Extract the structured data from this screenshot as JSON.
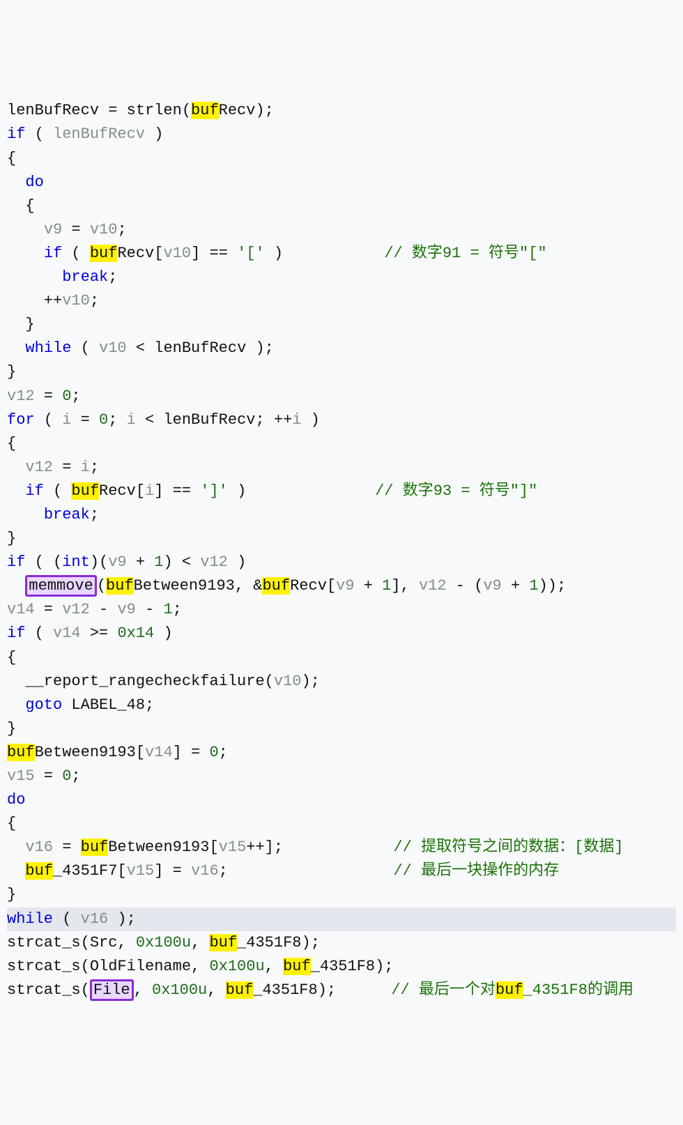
{
  "tokens": [
    {
      "t": "lenBufRecv = strlen(",
      "c": "sym"
    },
    {
      "t": "buf",
      "c": "hl-y"
    },
    {
      "t": "Recv);",
      "c": "sym"
    },
    "\n",
    {
      "t": "if",
      "c": "kw"
    },
    {
      "t": " ( ",
      "c": "sym"
    },
    {
      "t": "lenBufRecv",
      "c": "var"
    },
    {
      "t": " )",
      "c": "sym"
    },
    "\n",
    {
      "t": "{",
      "c": "sym"
    },
    "\n",
    {
      "t": "  ",
      "c": "sym"
    },
    {
      "t": "do",
      "c": "kw"
    },
    "\n",
    {
      "t": "  {",
      "c": "sym"
    },
    "\n",
    {
      "t": "    ",
      "c": "sym"
    },
    {
      "t": "v9",
      "c": "var"
    },
    {
      "t": " = ",
      "c": "sym"
    },
    {
      "t": "v10",
      "c": "var"
    },
    {
      "t": ";",
      "c": "sym"
    },
    "\n",
    {
      "t": "    ",
      "c": "sym"
    },
    {
      "t": "if",
      "c": "kw"
    },
    {
      "t": " ( ",
      "c": "sym"
    },
    {
      "t": "buf",
      "c": "hl-y"
    },
    {
      "t": "Recv[",
      "c": "sym"
    },
    {
      "t": "v10",
      "c": "var"
    },
    {
      "t": "] == ",
      "c": "sym"
    },
    {
      "t": "'['",
      "c": "char"
    },
    {
      "t": " )           ",
      "c": "sym"
    },
    {
      "t": "// 数字91 = 符号\"[\"",
      "c": "cmt"
    },
    "\n",
    {
      "t": "      ",
      "c": "sym"
    },
    {
      "t": "break",
      "c": "kw"
    },
    {
      "t": ";",
      "c": "sym"
    },
    "\n",
    {
      "t": "    ++",
      "c": "sym"
    },
    {
      "t": "v10",
      "c": "var"
    },
    {
      "t": ";",
      "c": "sym"
    },
    "\n",
    {
      "t": "  }",
      "c": "sym"
    },
    "\n",
    {
      "t": "  ",
      "c": "sym"
    },
    {
      "t": "while",
      "c": "kw"
    },
    {
      "t": " ( ",
      "c": "sym"
    },
    {
      "t": "v10",
      "c": "var"
    },
    {
      "t": " < lenBufRecv );",
      "c": "sym"
    },
    "\n",
    {
      "t": "}",
      "c": "sym"
    },
    "\n",
    {
      "t": "v12",
      "c": "var"
    },
    {
      "t": " = ",
      "c": "sym"
    },
    {
      "t": "0",
      "c": "num"
    },
    {
      "t": ";",
      "c": "sym"
    },
    "\n",
    {
      "t": "for",
      "c": "kw"
    },
    {
      "t": " ( ",
      "c": "sym"
    },
    {
      "t": "i",
      "c": "var"
    },
    {
      "t": " = ",
      "c": "sym"
    },
    {
      "t": "0",
      "c": "num"
    },
    {
      "t": "; ",
      "c": "sym"
    },
    {
      "t": "i",
      "c": "var"
    },
    {
      "t": " < lenBufRecv; ++",
      "c": "sym"
    },
    {
      "t": "i",
      "c": "var"
    },
    {
      "t": " )",
      "c": "sym"
    },
    "\n",
    {
      "t": "{",
      "c": "sym"
    },
    "\n",
    {
      "t": "  ",
      "c": "sym"
    },
    {
      "t": "v12",
      "c": "var"
    },
    {
      "t": " = ",
      "c": "sym"
    },
    {
      "t": "i",
      "c": "var"
    },
    {
      "t": ";",
      "c": "sym"
    },
    "\n",
    {
      "t": "  ",
      "c": "sym"
    },
    {
      "t": "if",
      "c": "kw"
    },
    {
      "t": " ( ",
      "c": "sym"
    },
    {
      "t": "buf",
      "c": "hl-y"
    },
    {
      "t": "Recv[",
      "c": "sym"
    },
    {
      "t": "i",
      "c": "var"
    },
    {
      "t": "] == ",
      "c": "sym"
    },
    {
      "t": "']'",
      "c": "char"
    },
    {
      "t": " )              ",
      "c": "sym"
    },
    {
      "t": "// 数字93 = 符号\"]\"",
      "c": "cmt"
    },
    "\n",
    {
      "t": "    ",
      "c": "sym"
    },
    {
      "t": "break",
      "c": "kw"
    },
    {
      "t": ";",
      "c": "sym"
    },
    "\n",
    {
      "t": "}",
      "c": "sym"
    },
    "\n",
    {
      "t": "if",
      "c": "kw"
    },
    {
      "t": " ( (",
      "c": "sym"
    },
    {
      "t": "int",
      "c": "kw"
    },
    {
      "t": ")(",
      "c": "sym"
    },
    {
      "t": "v9",
      "c": "var"
    },
    {
      "t": " + ",
      "c": "sym"
    },
    {
      "t": "1",
      "c": "num"
    },
    {
      "t": ") < ",
      "c": "sym"
    },
    {
      "t": "v12",
      "c": "var"
    },
    {
      "t": " )",
      "c": "sym"
    },
    "\n",
    {
      "t": "  ",
      "c": "sym"
    },
    {
      "t": "memmove",
      "c": "hl-box"
    },
    {
      "t": "(",
      "c": "sym"
    },
    {
      "t": "buf",
      "c": "hl-y"
    },
    {
      "t": "Between9193, &",
      "c": "sym"
    },
    {
      "t": "buf",
      "c": "hl-y"
    },
    {
      "t": "Recv[",
      "c": "sym"
    },
    {
      "t": "v9",
      "c": "var"
    },
    {
      "t": " + ",
      "c": "sym"
    },
    {
      "t": "1",
      "c": "num"
    },
    {
      "t": "], ",
      "c": "sym"
    },
    {
      "t": "v12",
      "c": "var"
    },
    {
      "t": " - (",
      "c": "sym"
    },
    {
      "t": "v9",
      "c": "var"
    },
    {
      "t": " + ",
      "c": "sym"
    },
    {
      "t": "1",
      "c": "num"
    },
    {
      "t": "));",
      "c": "sym"
    },
    "\n",
    {
      "t": "v14",
      "c": "var"
    },
    {
      "t": " = ",
      "c": "sym"
    },
    {
      "t": "v12",
      "c": "var"
    },
    {
      "t": " - ",
      "c": "sym"
    },
    {
      "t": "v9",
      "c": "var"
    },
    {
      "t": " - ",
      "c": "sym"
    },
    {
      "t": "1",
      "c": "num"
    },
    {
      "t": ";",
      "c": "sym"
    },
    "\n",
    {
      "t": "if",
      "c": "kw"
    },
    {
      "t": " ( ",
      "c": "sym"
    },
    {
      "t": "v14",
      "c": "var"
    },
    {
      "t": " >= ",
      "c": "sym"
    },
    {
      "t": "0x14",
      "c": "num"
    },
    {
      "t": " )",
      "c": "sym"
    },
    "\n",
    {
      "t": "{",
      "c": "sym"
    },
    "\n",
    {
      "t": "  __report_rangecheckfailure(",
      "c": "sym"
    },
    {
      "t": "v10",
      "c": "var"
    },
    {
      "t": ");",
      "c": "sym"
    },
    "\n",
    {
      "t": "  ",
      "c": "sym"
    },
    {
      "t": "goto",
      "c": "kw"
    },
    {
      "t": " LABEL_48;",
      "c": "sym"
    },
    "\n",
    {
      "t": "}",
      "c": "sym"
    },
    "\n",
    {
      "t": "buf",
      "c": "hl-y"
    },
    {
      "t": "Between9193[",
      "c": "sym"
    },
    {
      "t": "v14",
      "c": "var"
    },
    {
      "t": "] = ",
      "c": "sym"
    },
    {
      "t": "0",
      "c": "num"
    },
    {
      "t": ";",
      "c": "sym"
    },
    "\n",
    {
      "t": "v15",
      "c": "var"
    },
    {
      "t": " = ",
      "c": "sym"
    },
    {
      "t": "0",
      "c": "num"
    },
    {
      "t": ";",
      "c": "sym"
    },
    "\n",
    {
      "t": "do",
      "c": "kw"
    },
    "\n",
    {
      "t": "{",
      "c": "sym"
    },
    "\n",
    {
      "t": "  ",
      "c": "sym"
    },
    {
      "t": "v16",
      "c": "var"
    },
    {
      "t": " = ",
      "c": "sym"
    },
    {
      "t": "buf",
      "c": "hl-y"
    },
    {
      "t": "Between9193[",
      "c": "sym"
    },
    {
      "t": "v15",
      "c": "var"
    },
    {
      "t": "++];            ",
      "c": "sym"
    },
    {
      "t": "// 提取符号之间的数据：[数据]",
      "c": "cmt"
    },
    "\n",
    {
      "t": "  ",
      "c": "sym"
    },
    {
      "t": "buf",
      "c": "hl-y"
    },
    {
      "t": "_4351F7[",
      "c": "sym"
    },
    {
      "t": "v15",
      "c": "var"
    },
    {
      "t": "] = ",
      "c": "sym"
    },
    {
      "t": "v16",
      "c": "var"
    },
    {
      "t": ";                  ",
      "c": "sym"
    },
    {
      "t": "// 最后一块操作的内存",
      "c": "cmt"
    },
    "\n",
    {
      "t": "}",
      "c": "sym"
    },
    "\n",
    {
      "span": "line-hl",
      "inner": [
        {
          "t": "while",
          "c": "kw"
        },
        {
          "t": " ( ",
          "c": "sym"
        },
        {
          "t": "v16",
          "c": "var"
        },
        {
          "t": " );",
          "c": "sym"
        }
      ]
    },
    "\n",
    {
      "t": "strcat_s(Src, ",
      "c": "sym"
    },
    {
      "t": "0x100u",
      "c": "num"
    },
    {
      "t": ", ",
      "c": "sym"
    },
    {
      "t": "buf",
      "c": "hl-y"
    },
    {
      "t": "_4351F8);",
      "c": "sym"
    },
    "\n",
    {
      "t": "strcat_s(OldFilename, ",
      "c": "sym"
    },
    {
      "t": "0x100u",
      "c": "num"
    },
    {
      "t": ", ",
      "c": "sym"
    },
    {
      "t": "buf",
      "c": "hl-y"
    },
    {
      "t": "_4351F8);",
      "c": "sym"
    },
    "\n",
    {
      "t": "strcat_s(",
      "c": "sym"
    },
    {
      "t": "File",
      "c": "hl-box"
    },
    {
      "t": ", ",
      "c": "sym"
    },
    {
      "t": "0x100u",
      "c": "num"
    },
    {
      "t": ", ",
      "c": "sym"
    },
    {
      "t": "buf",
      "c": "hl-y"
    },
    {
      "t": "_4351F8);      ",
      "c": "sym"
    },
    {
      "t": "// 最后一个对",
      "c": "cmt"
    },
    {
      "t": "buf",
      "c": "hl-y"
    },
    {
      "t": "_4351F8的调用",
      "c": "cmt"
    }
  ]
}
